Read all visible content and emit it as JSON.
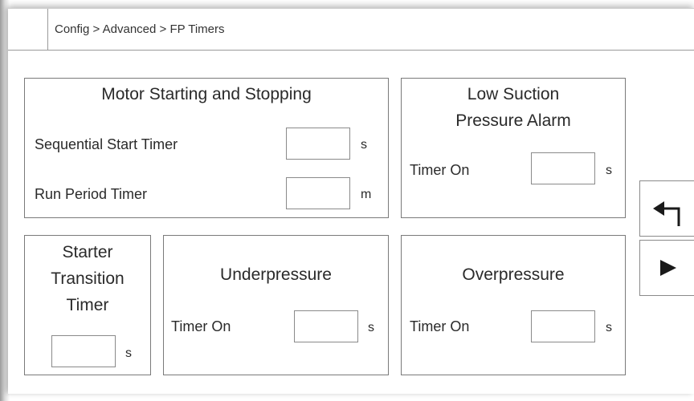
{
  "breadcrumb": "Config > Advanced > FP Timers",
  "motor_panel": {
    "title": "Motor Starting and Stopping",
    "sequential_start": {
      "label": "Sequential Start Timer",
      "value": "",
      "unit": "s"
    },
    "run_period": {
      "label": "Run Period Timer",
      "value": "",
      "unit": "m"
    }
  },
  "low_suction_panel": {
    "title_line1": "Low Suction",
    "title_line2": "Pressure Alarm",
    "timer_on": {
      "label": "Timer On",
      "value": "",
      "unit": "s"
    }
  },
  "starter_panel": {
    "title_line1": "Starter",
    "title_line2": "Transition",
    "title_line3": "Timer",
    "timer": {
      "value": "",
      "unit": "s"
    }
  },
  "underpressure_panel": {
    "title": "Underpressure",
    "timer_on": {
      "label": "Timer On",
      "value": "",
      "unit": "s"
    }
  },
  "overpressure_panel": {
    "title": "Overpressure",
    "timer_on": {
      "label": "Timer On",
      "value": "",
      "unit": "s"
    }
  },
  "side_buttons": {
    "back_icon": "return-arrow-icon",
    "next_icon": "play-right-icon"
  }
}
